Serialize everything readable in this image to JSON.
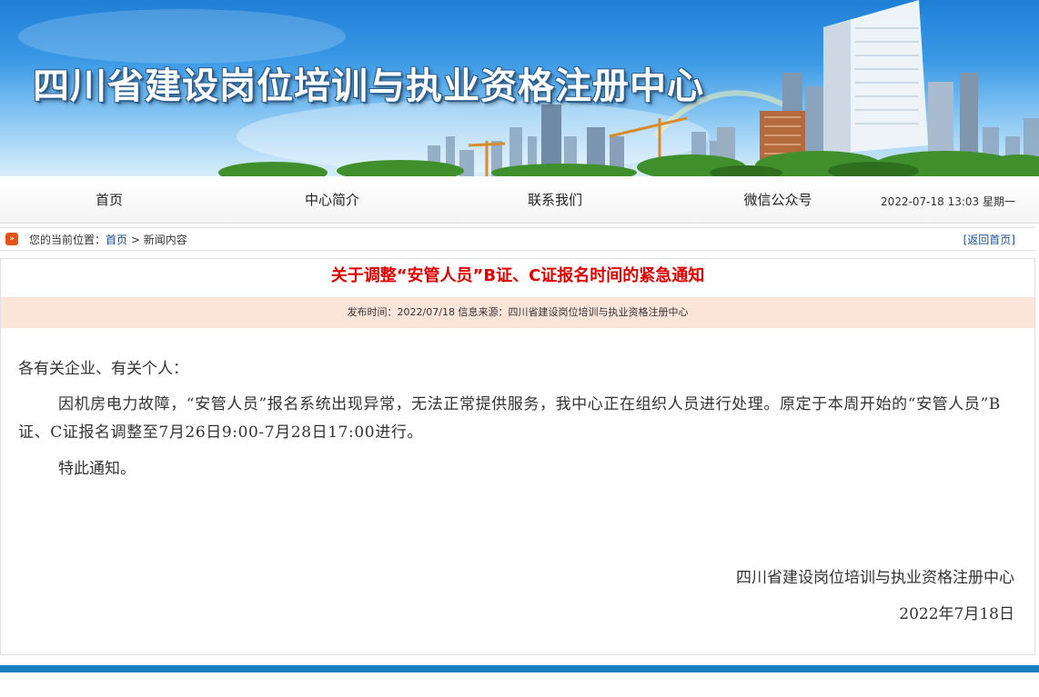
{
  "banner": {
    "title": "四川省建设岗位培训与执业资格注册中心"
  },
  "nav": {
    "items": [
      {
        "label": "首页"
      },
      {
        "label": "中心简介"
      },
      {
        "label": "联系我们"
      },
      {
        "label": "微信公众号"
      }
    ],
    "datetime": "2022-07-18 13:03 星期一"
  },
  "breadcrumb": {
    "label": "您的当前位置：",
    "home": "首页",
    "separator": " > ",
    "current": "新闻内容",
    "back": "[返回首页]"
  },
  "article": {
    "title": "关于调整“安管人员”B证、C证报名时间的紧急通知",
    "meta": "发布时间：2022/07/18 信息来源：四川省建设岗位培训与执业资格注册中心",
    "greeting": "各有关企业、有关个人：",
    "paragraph": "因机房电力故障，“安管人员”报名系统出现异常，无法正常提供服务，我中心正在组织人员进行处理。原定于本周开始的“安管人员”B证、C证报名调整至7月26日9:00-7月28日17:00进行。",
    "closing": "特此通知。",
    "signature_org": "四川省建设岗位培训与执业资格注册中心",
    "signature_date": "2022年7月18日"
  },
  "colors": {
    "title_red": "#e00000",
    "meta_bg": "#fbe5d8",
    "link_blue": "#1a4f8f",
    "footer_blue": "#1a7fc2"
  }
}
